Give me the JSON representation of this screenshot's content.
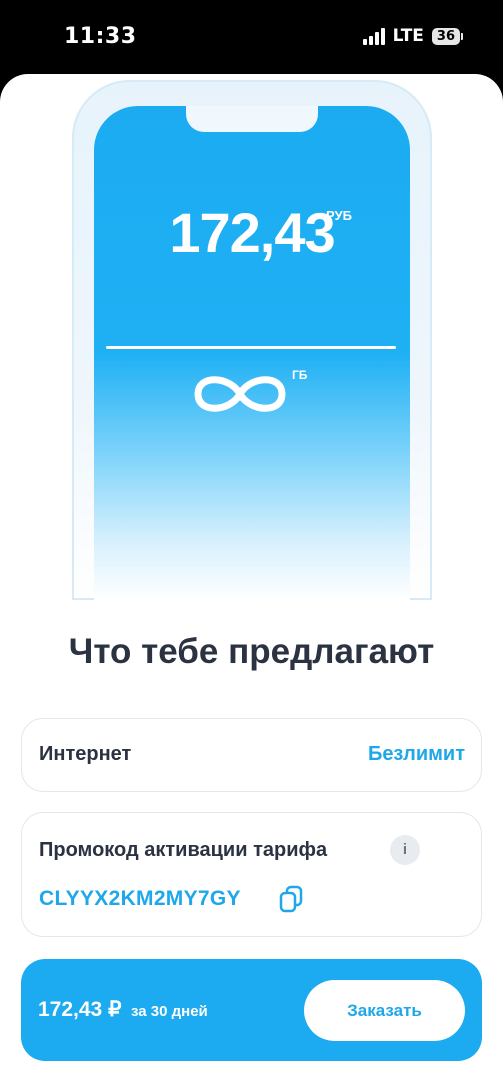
{
  "status_bar": {
    "time": "11:33",
    "network": "LTE",
    "battery": "36"
  },
  "hero": {
    "balance_value": "172,43",
    "balance_unit": "РУБ",
    "data_symbol": "infinity",
    "data_unit": "ГБ"
  },
  "heading": "Что тебе предлагают",
  "internet_card": {
    "label": "Интернет",
    "value": "Безлимит"
  },
  "promo_card": {
    "label": "Промокод активации тарифа",
    "info_glyph": "i",
    "code": "CLYYX2KM2MY7GY"
  },
  "order_bar": {
    "price": "172,43 ₽",
    "period": "за 30 дней",
    "button_label": "Заказать"
  },
  "colors": {
    "accent": "#1CABF1",
    "text_dark": "#2B3342",
    "link": "#1EA8EA"
  }
}
